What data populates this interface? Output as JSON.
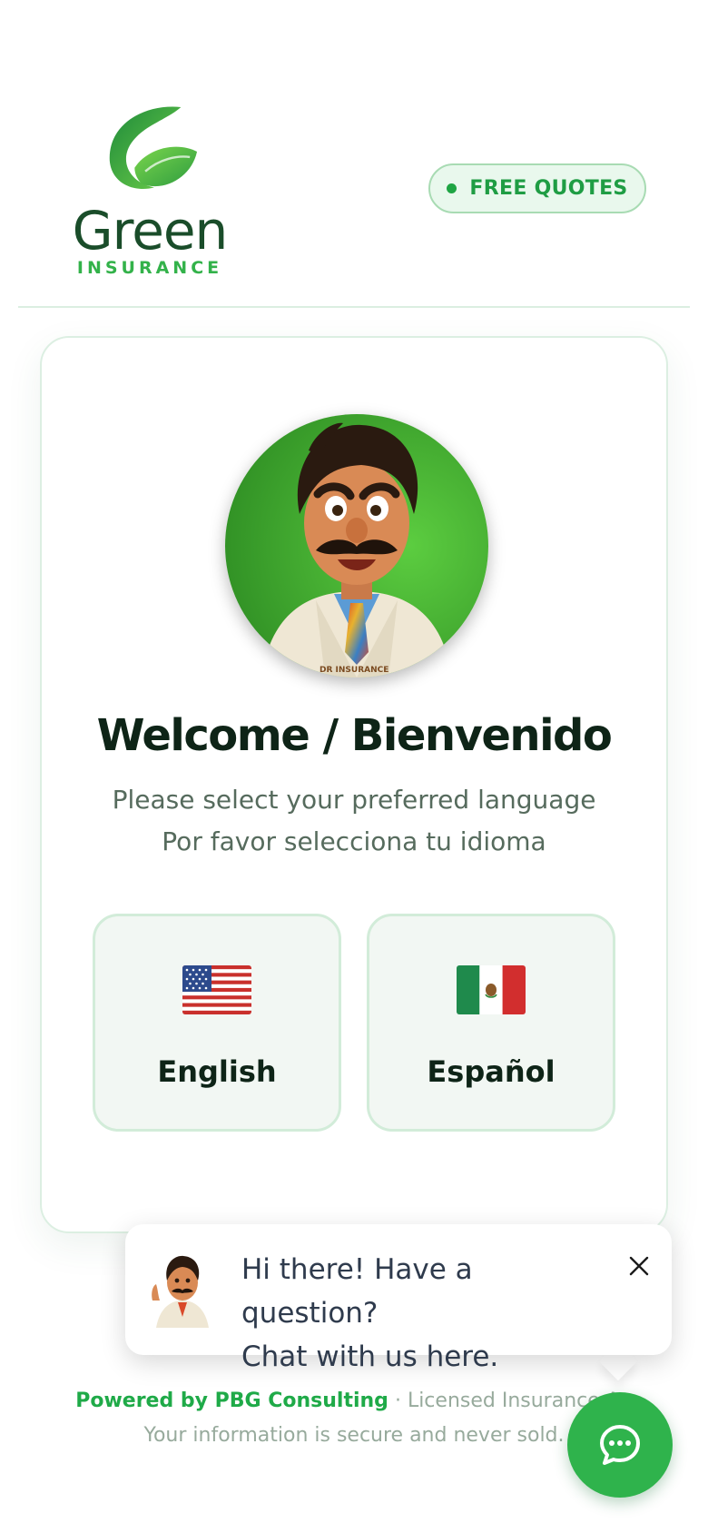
{
  "header": {
    "logo": {
      "word": "Green",
      "subword": "INSURANCE",
      "icon": "leaf-g-logo-icon",
      "brand_color": "#33b24a"
    },
    "badge": {
      "label": "FREE QUOTES",
      "dot_color": "#1fa544"
    }
  },
  "card": {
    "avatar": {
      "icon": "doctor-mascot-avatar",
      "coat_text": "DR INSURANCE"
    },
    "title": "Welcome / Bienvenido",
    "subtitle_en": "Please select your preferred language",
    "subtitle_es": "Por favor selecciona tu idioma",
    "languages": [
      {
        "label": "English",
        "flag_icon": "us-flag-icon"
      },
      {
        "label": "Español",
        "flag_icon": "mexico-flag-icon"
      }
    ]
  },
  "footer": {
    "brand": "Powered by PBG Consulting",
    "separator": "·",
    "agency": "Licensed Insurance Ag",
    "privacy": "Your information is secure and never sold."
  },
  "chat": {
    "popup_line1": "Hi there! Have a question?",
    "popup_line2": "Chat with us here.",
    "close_icon": "close-icon",
    "fab_icon": "chat-bubble-icon",
    "fab_color": "#2fb34c"
  }
}
